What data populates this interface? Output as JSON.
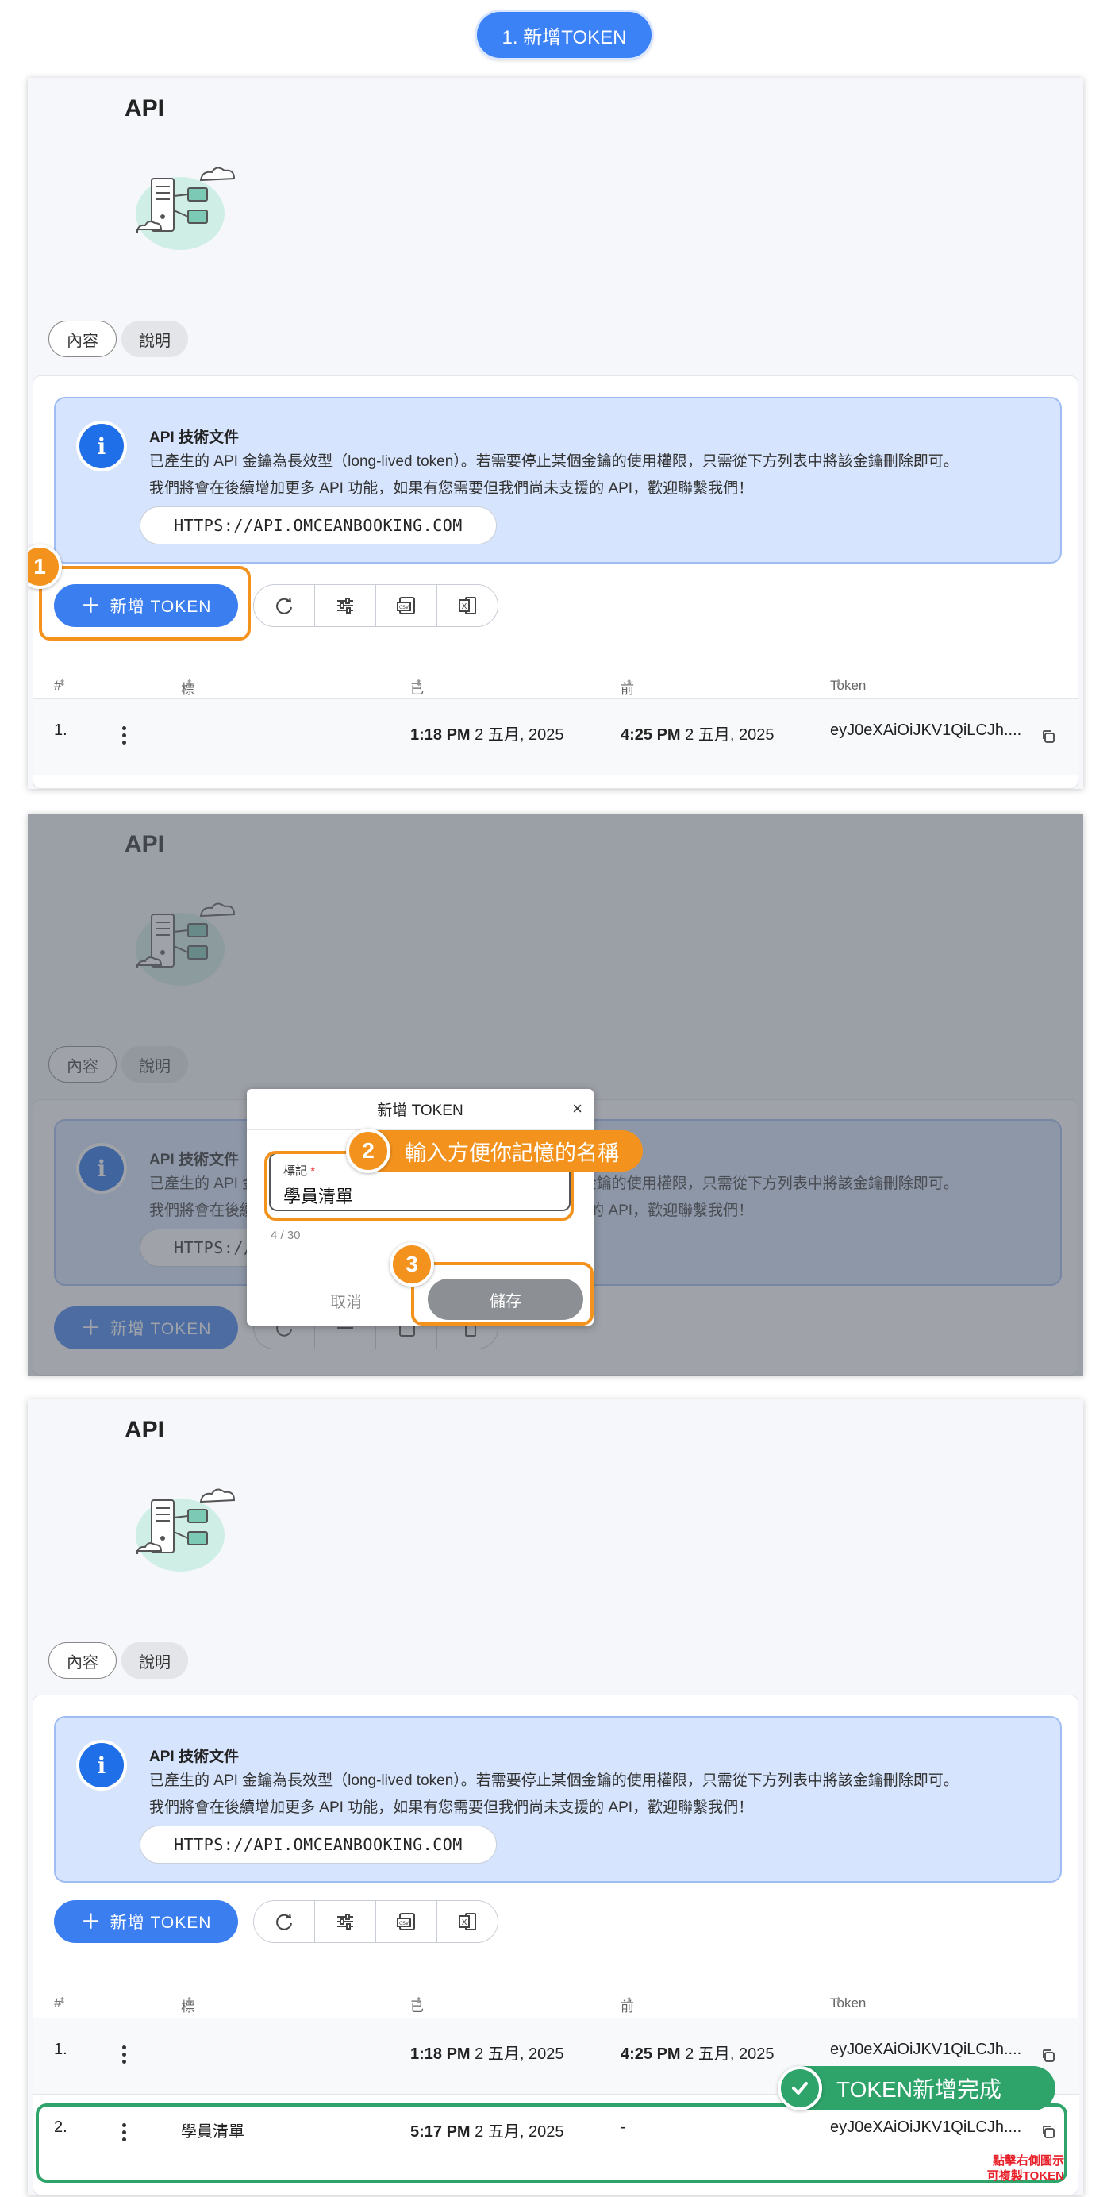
{
  "header": {
    "step_title": "1. 新增TOKEN"
  },
  "page": {
    "title": "API"
  },
  "tabs": {
    "content": "內容",
    "help": "說明"
  },
  "info": {
    "title": "API 技術文件",
    "line1": "已產生的 API 金鑰為長效型（long-lived token）。若需要停止某個金鑰的使用權限，只需從下方列表中將該金鑰刪除即可。",
    "line2": "我們將會在後續增加更多 API 功能，如果有您需要但我們尚未支援的 API，歡迎聯繫我們！",
    "url": "HTTPS://API.OMCEANBOOKING.COM"
  },
  "toolbar": {
    "add_label": "新增 TOKEN",
    "plus": "＋",
    "refresh_icon": "refresh-icon",
    "filter_icon": "sliders-icon",
    "csv_icon": "csv-export-icon",
    "excel_icon": "excel-export-icon"
  },
  "table": {
    "columns": {
      "num": "#",
      "label": "標記",
      "created": "已建立",
      "last_used": "前次使用",
      "token": "Token"
    },
    "sort_glyph": "⬍",
    "rows": [
      {
        "num": "1.",
        "label": "",
        "created_time": "1:18 PM",
        "created_date": "2 五月, 2025",
        "used_time": "4:25 PM",
        "used_date": "2 五月, 2025",
        "token": "eyJ0eXAiOiJKV1QiLCJh...."
      },
      {
        "num": "2.",
        "label": "學員清單",
        "created_time": "5:17 PM",
        "created_date": "2 五月, 2025",
        "used_time": "",
        "used_date": "-",
        "token": "eyJ0eXAiOiJKV1QiLCJh...."
      }
    ]
  },
  "modal": {
    "title": "新增 TOKEN",
    "close": "×",
    "field_label": "標記",
    "required_mark": "*",
    "field_value": "學員清單",
    "counter": "4 / 30",
    "cancel": "取消",
    "save": "儲存"
  },
  "steps": {
    "one": "1",
    "two": "2",
    "three": "3",
    "two_text": "輸入方便你記憶的名稱"
  },
  "done": {
    "text": "TOKEN新增完成",
    "note_l1": "點擊右側圖示",
    "note_l2": "可複製TOKEN"
  },
  "colors": {
    "accent": "#3a7ef0",
    "highlight": "#f3931e",
    "success": "#2ea36a",
    "info_bg": "#d6e4fd"
  }
}
